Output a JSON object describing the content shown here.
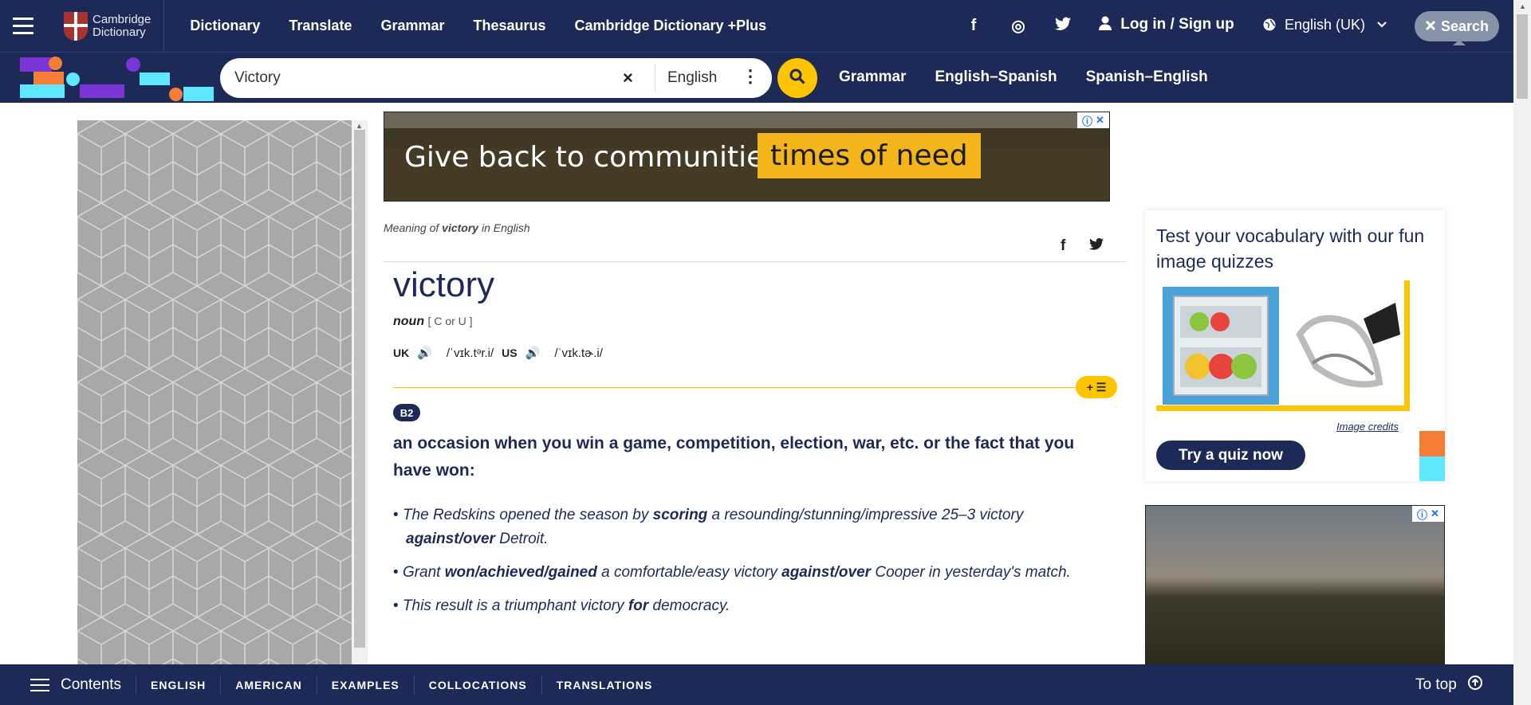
{
  "header": {
    "logo_line1": "Cambridge",
    "logo_line2": "Dictionary",
    "nav": [
      "Dictionary",
      "Translate",
      "Grammar",
      "Thesaurus",
      "Cambridge Dictionary +Plus"
    ],
    "social": {
      "facebook": "f",
      "instagram": "◎",
      "twitter": "🐦"
    },
    "login": "Log in / Sign up",
    "language": "English (UK)",
    "search_label": "Search"
  },
  "search": {
    "query": "Victory",
    "clear": "×",
    "dictionary": "English",
    "more": "⋮"
  },
  "subnav": [
    "Grammar",
    "English–Spanish",
    "Spanish–English"
  ],
  "ad_top": {
    "text": "Give back to communities in",
    "highlight": "times of need",
    "choice_i": "ⓘ",
    "choice_x": "✕"
  },
  "entry": {
    "meaning_prefix": "Meaning of ",
    "meaning_word": "victory",
    "meaning_suffix": " in English",
    "share_fb": "f",
    "share_tw": "🐦",
    "headword": "victory",
    "pos": "noun",
    "grammar": "[ C or U ]",
    "uk_label": "UK",
    "uk_ipa": "/ˈvɪk.tᵊr.i/",
    "us_label": "US",
    "us_ipa": "/ˈvɪk.tɚ.i/",
    "audio_icon": "🔊",
    "add_button": "+ ☰",
    "level": "B2",
    "definition": "an occasion when you win a game, competition, election, war, etc. or the fact that you have won:",
    "examples": [
      {
        "parts": [
          "The Redskins opened the season by ",
          "scoring",
          " a resounding/stunning/impressive 25–3 victory ",
          "against/over",
          " Detroit."
        ]
      },
      {
        "parts": [
          "Grant ",
          "won/achieved/gained",
          " a comfortable/easy victory ",
          "against/over",
          " Cooper in yesterday's match."
        ]
      },
      {
        "parts": [
          "This result is a triumphant victory ",
          "for",
          " democracy."
        ]
      }
    ]
  },
  "quiz": {
    "title": "Test your vocabulary with our fun image quizzes",
    "credits": "Image credits",
    "button": "Try a quiz now"
  },
  "bottombar": {
    "contents": "Contents",
    "tabs": [
      "ENGLISH",
      "AMERICAN",
      "EXAMPLES",
      "COLLOCATIONS",
      "TRANSLATIONS"
    ],
    "to_top": "To top",
    "to_top_icon": "⬆"
  },
  "colors": {
    "navy": "#1d2a57",
    "yellow": "#fec400",
    "orange": "#f47e36",
    "cyan": "#5ee7ff",
    "purple": "#7a35d6"
  }
}
